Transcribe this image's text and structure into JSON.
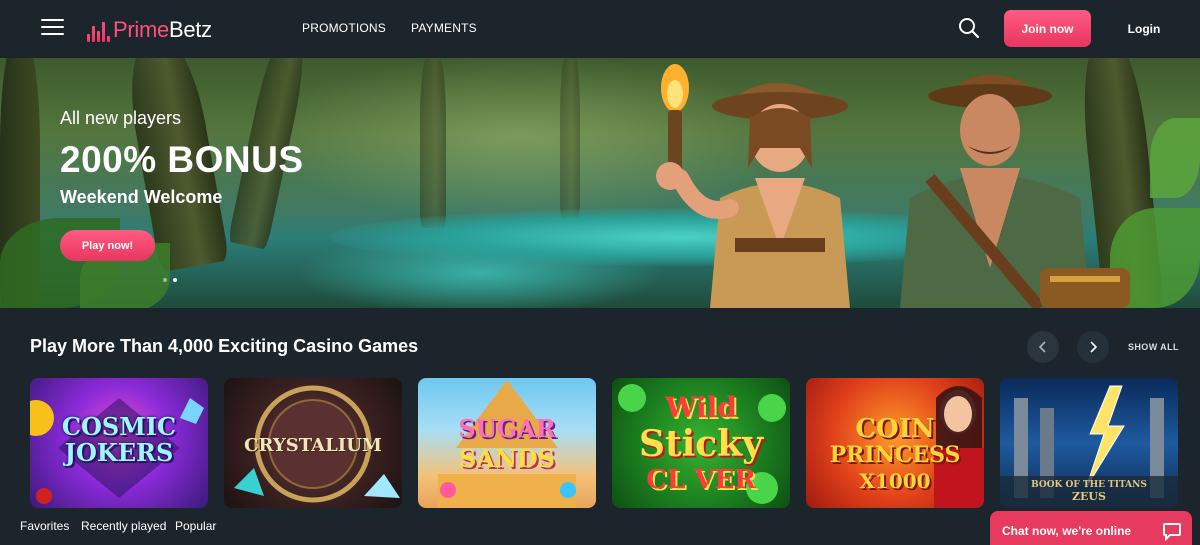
{
  "header": {
    "logo_part1": "Prime",
    "logo_part2": "Betz",
    "nav": [
      "PROMOTIONS",
      "PAYMENTS"
    ],
    "join_label": "Join now",
    "login_label": "Login"
  },
  "banner": {
    "subtitle": "All new players",
    "title": "200% BONUS",
    "description": "Weekend Welcome",
    "cta_label": "Play now!"
  },
  "games_section": {
    "title": "Play More Than 4,000 Exciting Casino Games",
    "show_all_label": "SHOW ALL",
    "games": [
      {
        "title": "COSMIC JOKERS",
        "line1": "COSMIC",
        "line2": "JOKERS"
      },
      {
        "title": "CRYSTALIUM",
        "line1": "CRYSTALIUM",
        "line2": ""
      },
      {
        "title": "SUGAR SANDS",
        "line1": "SUGAR",
        "line2": "SANDS"
      },
      {
        "title": "Wild Sticky Clover",
        "line1": "Wild",
        "line2": "Sticky",
        "line3": "CL  VER"
      },
      {
        "title": "COIN PRINCESS X1000",
        "line1": "COIN",
        "line2": "PRINCESS",
        "line3": "X1000"
      },
      {
        "title": "BOOK OF THE TITANS ZEUS",
        "line1": "BOOK OF THE TITANS",
        "line2": "ZEUS"
      }
    ]
  },
  "bottom_nav": [
    "Favorites",
    "Recently played",
    "Popular"
  ],
  "chat": {
    "label": "Chat now, we're online"
  },
  "colors": {
    "accent": "#e8365f",
    "background": "#1c252c"
  }
}
